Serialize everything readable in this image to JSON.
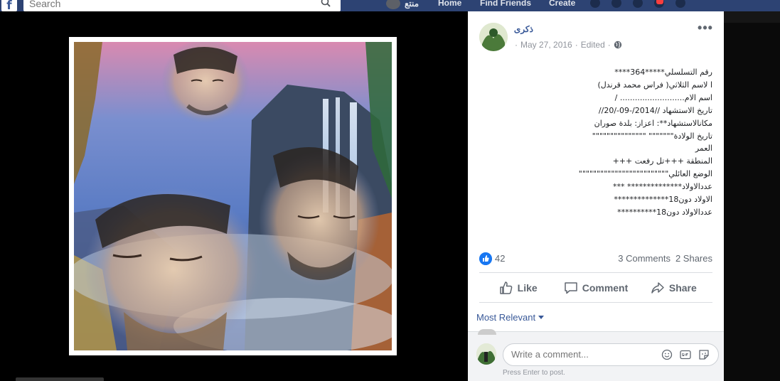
{
  "topbar": {
    "search_placeholder": "Search",
    "profile_name": "منتع",
    "home": "Home",
    "find_friends": "Find Friends",
    "create": "Create"
  },
  "post": {
    "author": "ذكرى",
    "date": "May 27, 2016",
    "edited": "Edited",
    "separator": "·",
    "lines": [
      "رقم التسلسلي*****364****",
      "ا لاسم الثلاثي( فراس محمد قرندل)",
      "اسم الام.......................... /",
      "تاريخ الاستشهاد //2014/-09-/20//",
      "مكانالاستشهاد**: اعزاز: بلدة صوران",
      "تاريخ الولادة\"\"\"\"\"\"\" \"\"\"\"\"\"\"\"\"\"\"\"\"\"\"",
      "العمر",
      "المنطقة +++تل رفعت +++",
      "الوضع العائلي\"\"\"\"\"\"\"\"\"\"\"\"\"\"\"\"\"\"\"\"\"\"\"\"\"",
      "عددالاولاد************** ***",
      "الاولاد دون18**************",
      "عددالاولاد دون18**********"
    ]
  },
  "stats": {
    "likes": "42",
    "comments": "3 Comments",
    "shares": "2 Shares"
  },
  "actions": {
    "like": "Like",
    "comment": "Comment",
    "share": "Share"
  },
  "comments": {
    "sort_label": "Most Relevant",
    "placeholder": "Write a comment...",
    "hint": "Press Enter to post."
  },
  "colors": {
    "link": "#385898",
    "like_blue": "#1877f2",
    "topbar": "#2d4373"
  }
}
